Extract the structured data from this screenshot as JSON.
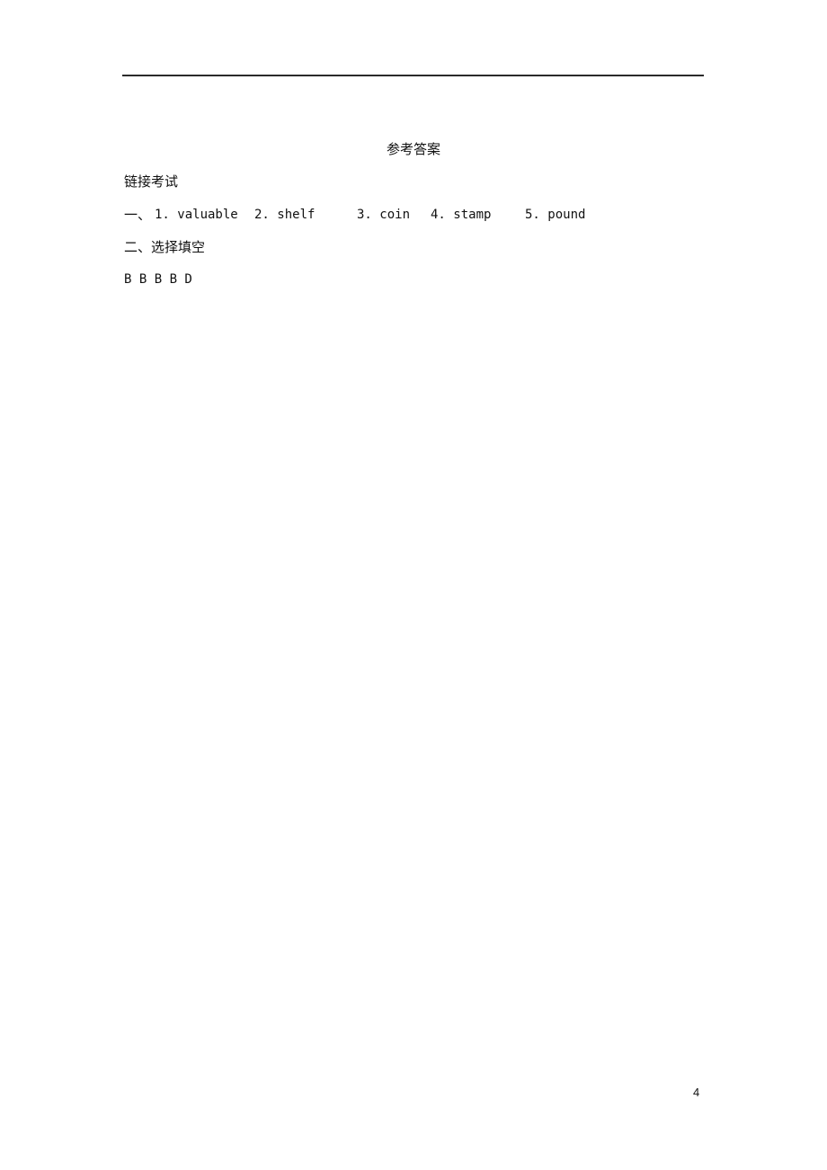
{
  "document": {
    "title": "参考答案",
    "section_heading": "链接考试",
    "part1": {
      "prefix": "一、",
      "answers": [
        {
          "label": "1. valuable"
        },
        {
          "label": "2. shelf"
        },
        {
          "label": "3. coin"
        },
        {
          "label": "4. stamp"
        },
        {
          "label": "5. pound"
        }
      ]
    },
    "part2": {
      "heading": "二、选择填空",
      "answers": "B B B B D"
    },
    "page_number": "4"
  }
}
